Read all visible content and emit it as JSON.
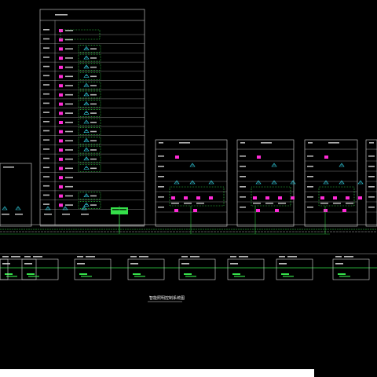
{
  "diagram": {
    "caption": "智能照明控制系统图"
  },
  "colors": {
    "background": "#000000",
    "frame": "#d9d9d9",
    "panel": "#ff2bd6",
    "sensor": "#33d6e8",
    "bus": "#35e04a",
    "controller": "#35e04a",
    "label": "#f2f2f2"
  },
  "icons": {
    "panel": "switch-panel-icon",
    "sensor": "motion-sensor-icon",
    "controller": "lighting-controller-icon"
  }
}
